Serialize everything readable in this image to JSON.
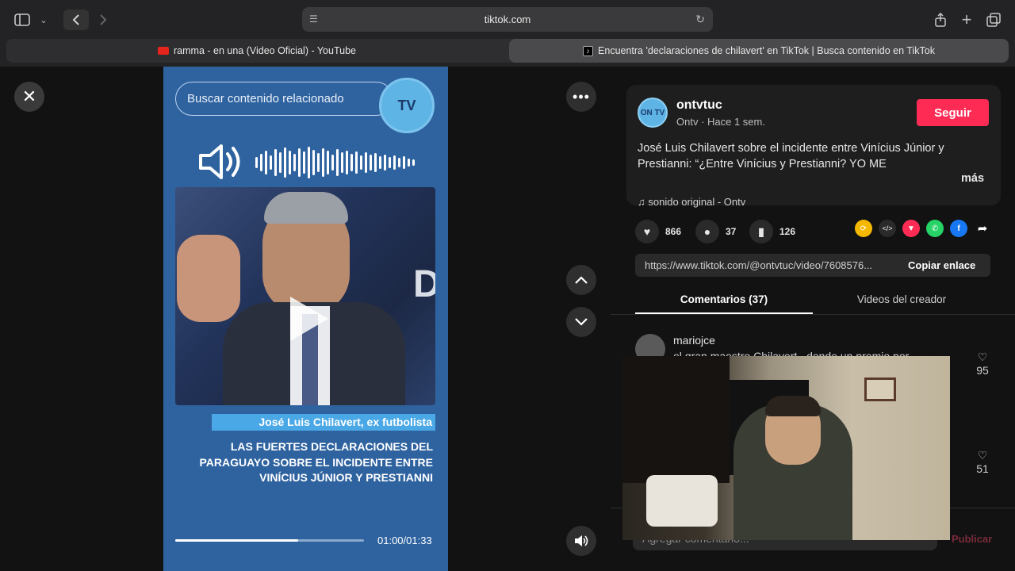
{
  "browser": {
    "url": "tiktok.com",
    "tabs": [
      {
        "label": "ramma - en una (Video Oficial) - YouTube",
        "active": false
      },
      {
        "label": "Encuentra 'declaraciones de chilavert' en TikTok | Busca contenido en TikTok",
        "active": true
      }
    ]
  },
  "video": {
    "search_placeholder": "Buscar contenido relacionado",
    "logo_text": "TV",
    "caption_name": "José Luis Chilavert, ex futbolista",
    "caption_headline": "LAS FUERTES DECLARACIONES DEL PARAGUAYO SOBRE EL INCIDENTE ENTRE VINÍCIUS JÚNIOR Y PRESTIANNI",
    "progress_fraction": 0.65,
    "time": "01:00/01:33"
  },
  "post": {
    "username": "ontvtuc",
    "avatar_text": "ON TV",
    "subline": "Ontv · Hace 1 sem.",
    "follow_label": "Seguir",
    "description": "José Luis Chilavert sobre el incidente entre Vinícius Júnior y Prestianni: “¿Entre Vinícius y Prestianni? YO ME",
    "more_label": "más",
    "sound": "sonido original - Ontv",
    "likes": "866",
    "comments": "37",
    "saves": "126",
    "link": "https://www.tiktok.com/@ontvtuc/video/7608576...",
    "copy_label": "Copiar enlace"
  },
  "tabs": {
    "comments": "Comentarios (37)",
    "creator": "Videos del creador"
  },
  "comments": [
    {
      "user": "mariojce",
      "text": "el gran maestro Chilavert.. donde un premio por",
      "likes": "95"
    },
    {
      "user": "",
      "text": "",
      "likes": "51"
    }
  ],
  "composer": {
    "placeholder": "Agregar comentario...",
    "publish": "Publicar"
  },
  "colors": {
    "accent": "#fe2c55",
    "video_bg": "#2f63a0",
    "caption_bar": "#4aa8e6"
  }
}
